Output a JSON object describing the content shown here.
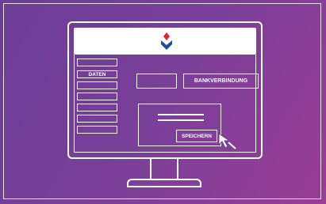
{
  "sidebar": {
    "items": [
      {
        "label": ""
      },
      {
        "label": "DATEN"
      },
      {
        "label": ""
      },
      {
        "label": ""
      },
      {
        "label": ""
      },
      {
        "label": ""
      },
      {
        "label": ""
      }
    ]
  },
  "bank": {
    "button_label": "BANKVERBINDUNG"
  },
  "form": {
    "save_label": "SPEICHERN"
  },
  "colors": {
    "background_start": "#6a3e98",
    "background_end": "#9a3d95",
    "logo_red": "#e2242c",
    "logo_blue": "#1f4fa0",
    "line": "#ffffff"
  },
  "icons": {
    "logo": "sparkasse-logo",
    "cursor": "arrow-cursor-icon"
  }
}
